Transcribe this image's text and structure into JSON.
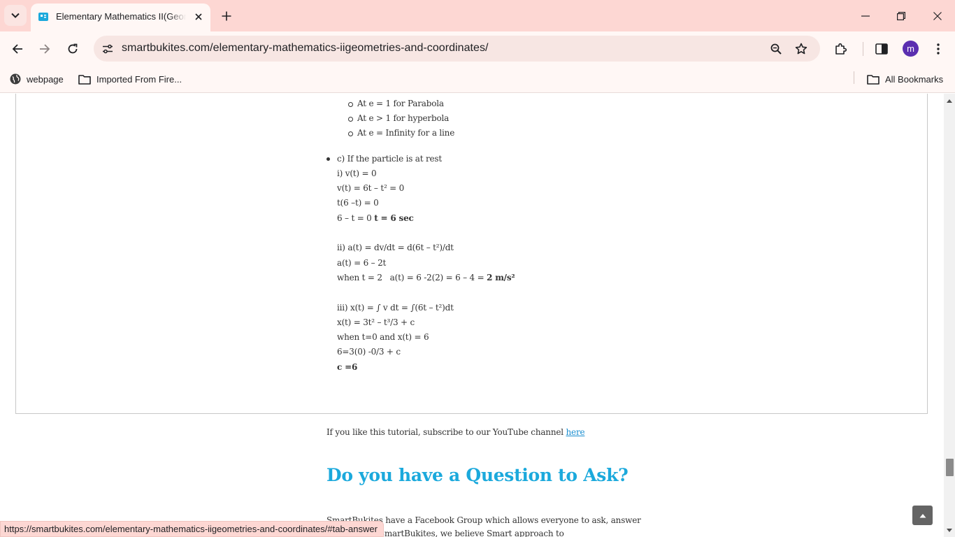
{
  "browser": {
    "tab_title": "Elementary Mathematics II(Geometries and Coordinates)",
    "url": "smartbukites.com/elementary-mathematics-iigeometries-and-coordinates/",
    "avatar_letter": "m",
    "bookmarks": [
      "webpage",
      "Imported From Fire..."
    ],
    "all_bookmarks": "All Bookmarks",
    "status_url": "https://smartbukites.com/elementary-mathematics-iigeometries-and-coordinates/#tab-answer",
    "accent_color": "#fdd7d3"
  },
  "content": {
    "eccentricity_items": [
      "At e = 1 for Parabola",
      "At e > 1 for hyperbola",
      "At e = Infinity for a line"
    ],
    "part_c_heading": "c) If the particle is at rest",
    "rest": {
      "l1": "i) v(t) = 0",
      "l2": "v(t) = 6t – t² = 0",
      "l3": "t(6 –t) = 0",
      "l4_prefix": "6 – t = 0 ",
      "l4_bold": "t = 6 sec"
    },
    "accel": {
      "l1": "ii) a(t) = dv/dt = d(6t – t²)/dt",
      "l2": "a(t) = 6 – 2t",
      "l3_prefix": "when t = 2   a(t) = 6 -2(2) = 6 – 4 = ",
      "l3_bold": "2 m/s²"
    },
    "position": {
      "l1": "iii) x(t) = ∫ v dt = ∫(6t – t²)dt",
      "l2": "x(t) = 3t² – t³/3 + c",
      "l3": "when t=0 and x(t) = 6",
      "l4": "6=3(0) -0/3 + c",
      "l5_bold": "c =6"
    },
    "youtube_text": "If you like this tutorial, subscribe to our YouTube channel ",
    "youtube_link": "here",
    "question_heading": "Do you have a Question to Ask?",
    "fb_line1": "SmartBukites have a Facebook Group which allows everyone to ask, answer",
    "fb_line2": "and help. At SmartBukites, we believe Smart approach to"
  }
}
